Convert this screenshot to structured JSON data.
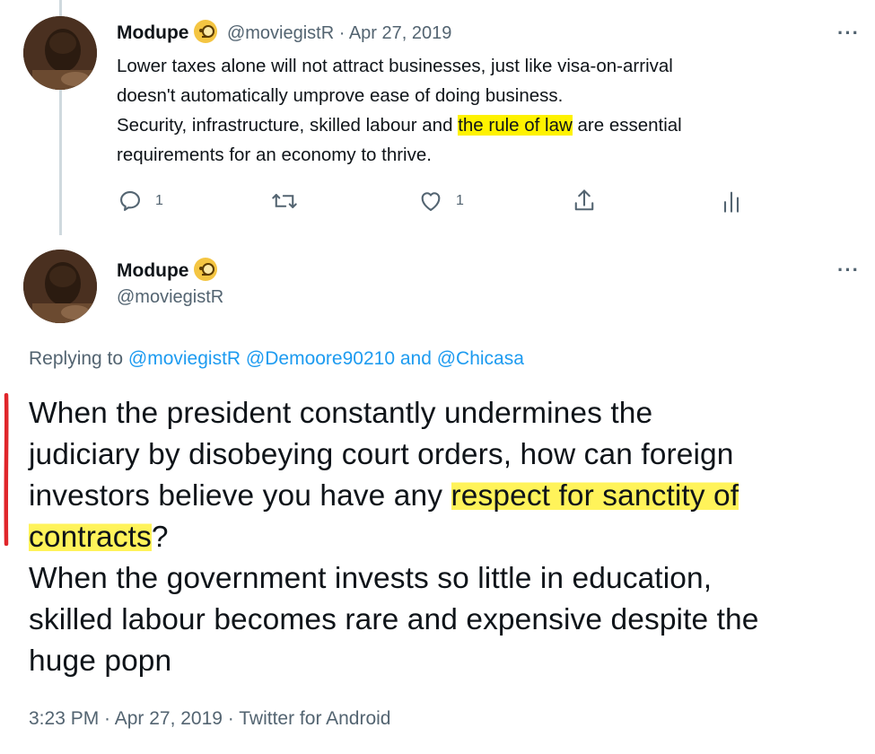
{
  "tweet1": {
    "name": "Modupe",
    "handle_date": "@moviegistR · Apr 27, 2019",
    "text_line1": "Lower taxes alone will not attract businesses, just like visa-on-arrival",
    "text_line2": "doesn't automatically umprove ease of doing business.",
    "text_line3_pre": "Security, infrastructure, skilled labour and ",
    "text_line3_highlight": "the rule of law",
    "text_line3_post": " are essential",
    "text_line4": "requirements for an economy to thrive.",
    "reply_count": "1",
    "like_count": "1",
    "emoji_icon": "face-with-monocle-icon"
  },
  "tweet2": {
    "name": "Modupe",
    "handle": "@moviegistR",
    "replying_to_prefix": "Replying to ",
    "replying_to_users": "@moviegistR @Demoore90210 and @Chicasa",
    "text_line1": "When the president constantly undermines the",
    "text_line2": "judiciary by disobeying court orders, how can foreign",
    "text_line3_pre": "investors believe you have any ",
    "text_line3_highlight": "respect for sanctity of",
    "text_line4_highlight": "contracts",
    "text_line4_post": "?",
    "text_line5": "When the government invests so little in education,",
    "text_line6": "skilled labour becomes rare and expensive despite the",
    "text_line7": "huge popn",
    "timestamp": "3:23 PM · Apr 27, 2019 · Twitter for Android"
  },
  "colors": {
    "link": "#1d9bf0",
    "muted": "#536471",
    "highlight": "#fef200",
    "annotation_red": "#e0262b"
  }
}
